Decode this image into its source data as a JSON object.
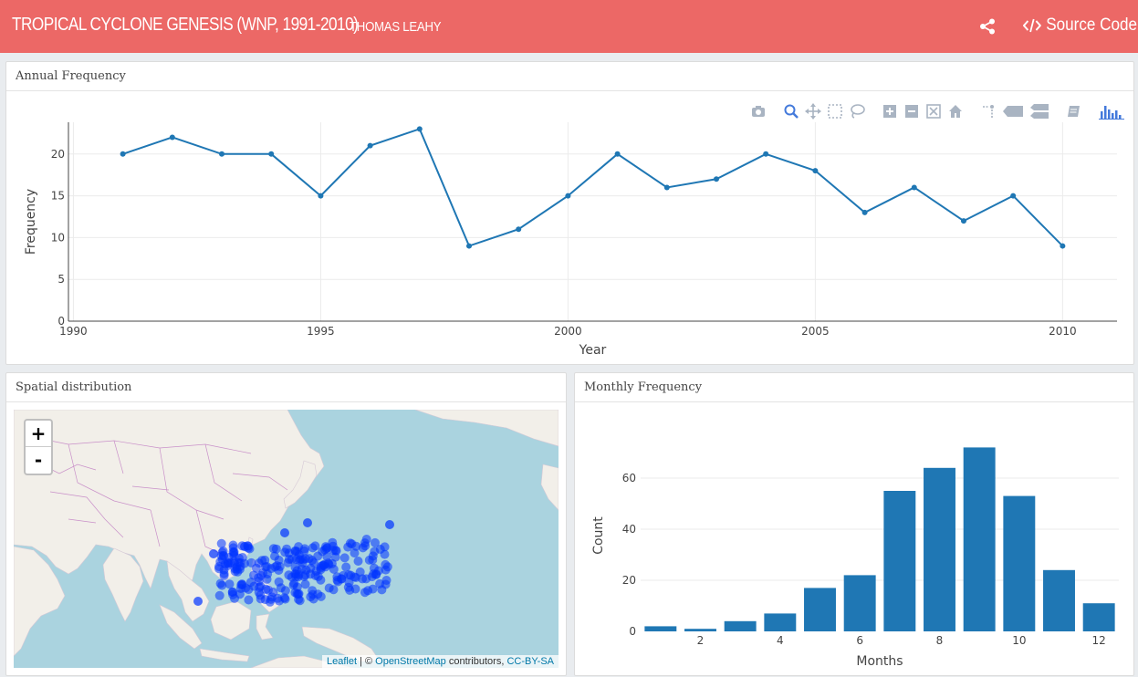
{
  "header": {
    "title": "TROPICAL CYCLONE GENESIS (WNP, 1991-2010)",
    "author": "THOMAS LEAHY",
    "source_label": "Source Code"
  },
  "panels": {
    "annual": "Annual Frequency",
    "spatial": "Spatial distribution",
    "monthly": "Monthly Frequency"
  },
  "map": {
    "zoom_in": "+",
    "zoom_out": "-",
    "attribution": {
      "leaflet": "Leaflet",
      "sep": " | © ",
      "osm": "OpenStreetMap",
      "contrib": " contributors, ",
      "license": "CC-BY-SA"
    },
    "point_color": "#0033ff"
  },
  "colors": {
    "accent": "#ec6866",
    "series": "#1f77b4"
  },
  "chart_data": [
    {
      "type": "line",
      "title": "",
      "xlabel": "Year",
      "ylabel": "Frequency",
      "xlim": [
        1989.9,
        2011.1
      ],
      "ylim": [
        0,
        23.8
      ],
      "xticks": [
        1990,
        1995,
        2000,
        2005,
        2010
      ],
      "yticks": [
        0,
        5,
        10,
        15,
        20
      ],
      "x": [
        1991,
        1992,
        1993,
        1994,
        1995,
        1996,
        1997,
        1998,
        1999,
        2000,
        2001,
        2002,
        2003,
        2004,
        2005,
        2006,
        2007,
        2008,
        2009,
        2010
      ],
      "y": [
        20,
        22,
        20,
        20,
        15,
        21,
        23,
        9,
        11,
        15,
        20,
        16,
        17,
        20,
        18,
        13,
        16,
        12,
        15,
        9
      ],
      "grid": true
    },
    {
      "type": "bar",
      "title": "",
      "xlabel": "Months",
      "ylabel": "Count",
      "xlim": [
        0.5,
        12.5
      ],
      "ylim": [
        0,
        75
      ],
      "xticks": [
        2,
        4,
        6,
        8,
        10,
        12
      ],
      "yticks": [
        0,
        20,
        40,
        60
      ],
      "categories": [
        1,
        2,
        3,
        4,
        5,
        6,
        7,
        8,
        9,
        10,
        11,
        12
      ],
      "values": [
        2,
        1,
        4,
        7,
        17,
        22,
        55,
        64,
        72,
        53,
        24,
        11
      ],
      "grid": true
    }
  ]
}
